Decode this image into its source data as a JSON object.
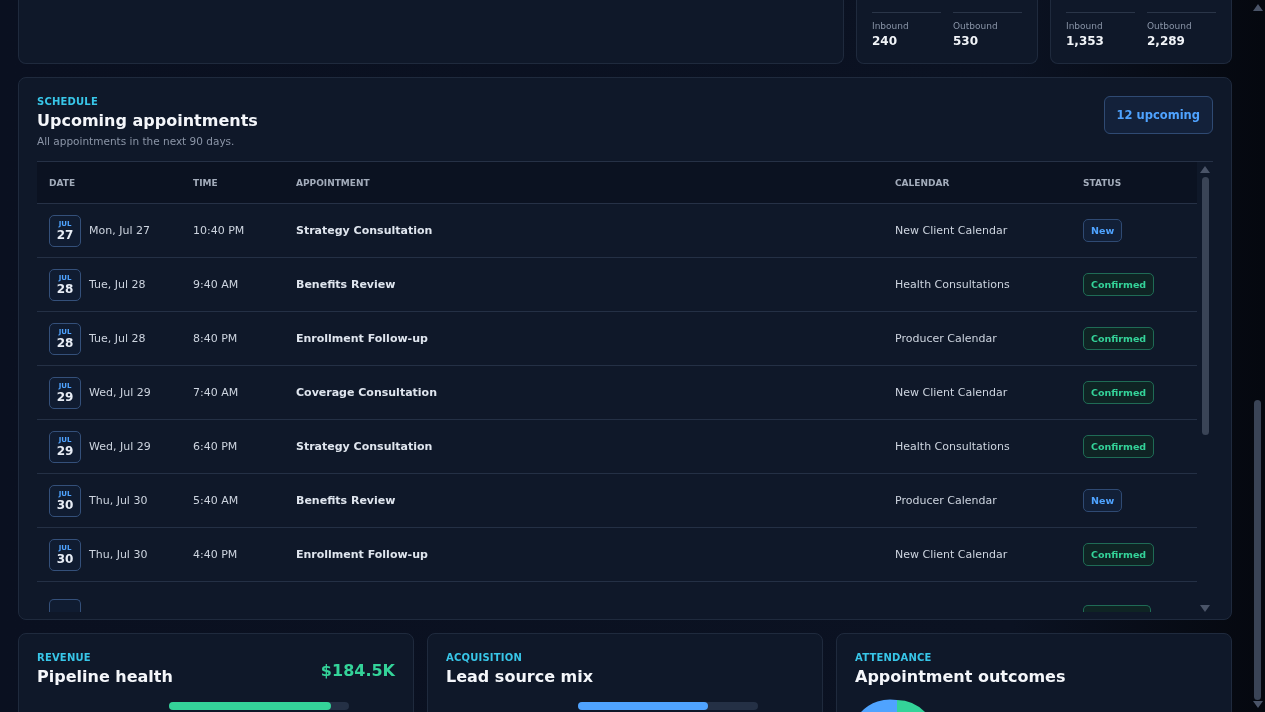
{
  "call_cards": [
    {
      "stats": [
        {
          "label": "Inbound",
          "value": "240"
        },
        {
          "label": "Outbound",
          "value": "530"
        }
      ]
    },
    {
      "stats": [
        {
          "label": "Inbound",
          "value": "1,353"
        },
        {
          "label": "Outbound",
          "value": "2,289"
        }
      ]
    }
  ],
  "schedule": {
    "eyebrow": "SCHEDULE",
    "title": "Upcoming appointments",
    "subtitle": "All appointments in the next 90 days.",
    "count_badge": "12 upcoming",
    "columns": [
      "DATE",
      "TIME",
      "APPOINTMENT",
      "CALENDAR",
      "STATUS"
    ],
    "rows": [
      {
        "month": "JUL",
        "day": "27",
        "date": "Mon, Jul 27",
        "time": "10:40 PM",
        "appointment": "Strategy Consultation",
        "calendar": "New Client Calendar",
        "status": "New",
        "kind": "new"
      },
      {
        "month": "JUL",
        "day": "28",
        "date": "Tue, Jul 28",
        "time": "9:40 AM",
        "appointment": "Benefits Review",
        "calendar": "Health Consultations",
        "status": "Confirmed",
        "kind": "confirmed"
      },
      {
        "month": "JUL",
        "day": "28",
        "date": "Tue, Jul 28",
        "time": "8:40 PM",
        "appointment": "Enrollment Follow-up",
        "calendar": "Producer Calendar",
        "status": "Confirmed",
        "kind": "confirmed"
      },
      {
        "month": "JUL",
        "day": "29",
        "date": "Wed, Jul 29",
        "time": "7:40 AM",
        "appointment": "Coverage Consultation",
        "calendar": "New Client Calendar",
        "status": "Confirmed",
        "kind": "confirmed"
      },
      {
        "month": "JUL",
        "day": "29",
        "date": "Wed, Jul 29",
        "time": "6:40 PM",
        "appointment": "Strategy Consultation",
        "calendar": "Health Consultations",
        "status": "Confirmed",
        "kind": "confirmed"
      },
      {
        "month": "JUL",
        "day": "30",
        "date": "Thu, Jul 30",
        "time": "5:40 AM",
        "appointment": "Benefits Review",
        "calendar": "Producer Calendar",
        "status": "New",
        "kind": "new"
      },
      {
        "month": "JUL",
        "day": "30",
        "date": "Thu, Jul 30",
        "time": "4:40 PM",
        "appointment": "Enrollment Follow-up",
        "calendar": "New Client Calendar",
        "status": "Confirmed",
        "kind": "confirmed"
      }
    ],
    "partial_row": {
      "kind": "confirmed"
    }
  },
  "bottom_cards": [
    {
      "eyebrow": "REVENUE",
      "title": "Pipeline health",
      "figure": "$184.5K",
      "kind": "bar",
      "level": 0.9
    },
    {
      "eyebrow": "ACQUISITION",
      "title": "Lead source mix",
      "kind": "bar",
      "level": 0.72
    },
    {
      "eyebrow": "ATTENDANCE",
      "title": "Appointment outcomes",
      "kind": "pie"
    }
  ]
}
